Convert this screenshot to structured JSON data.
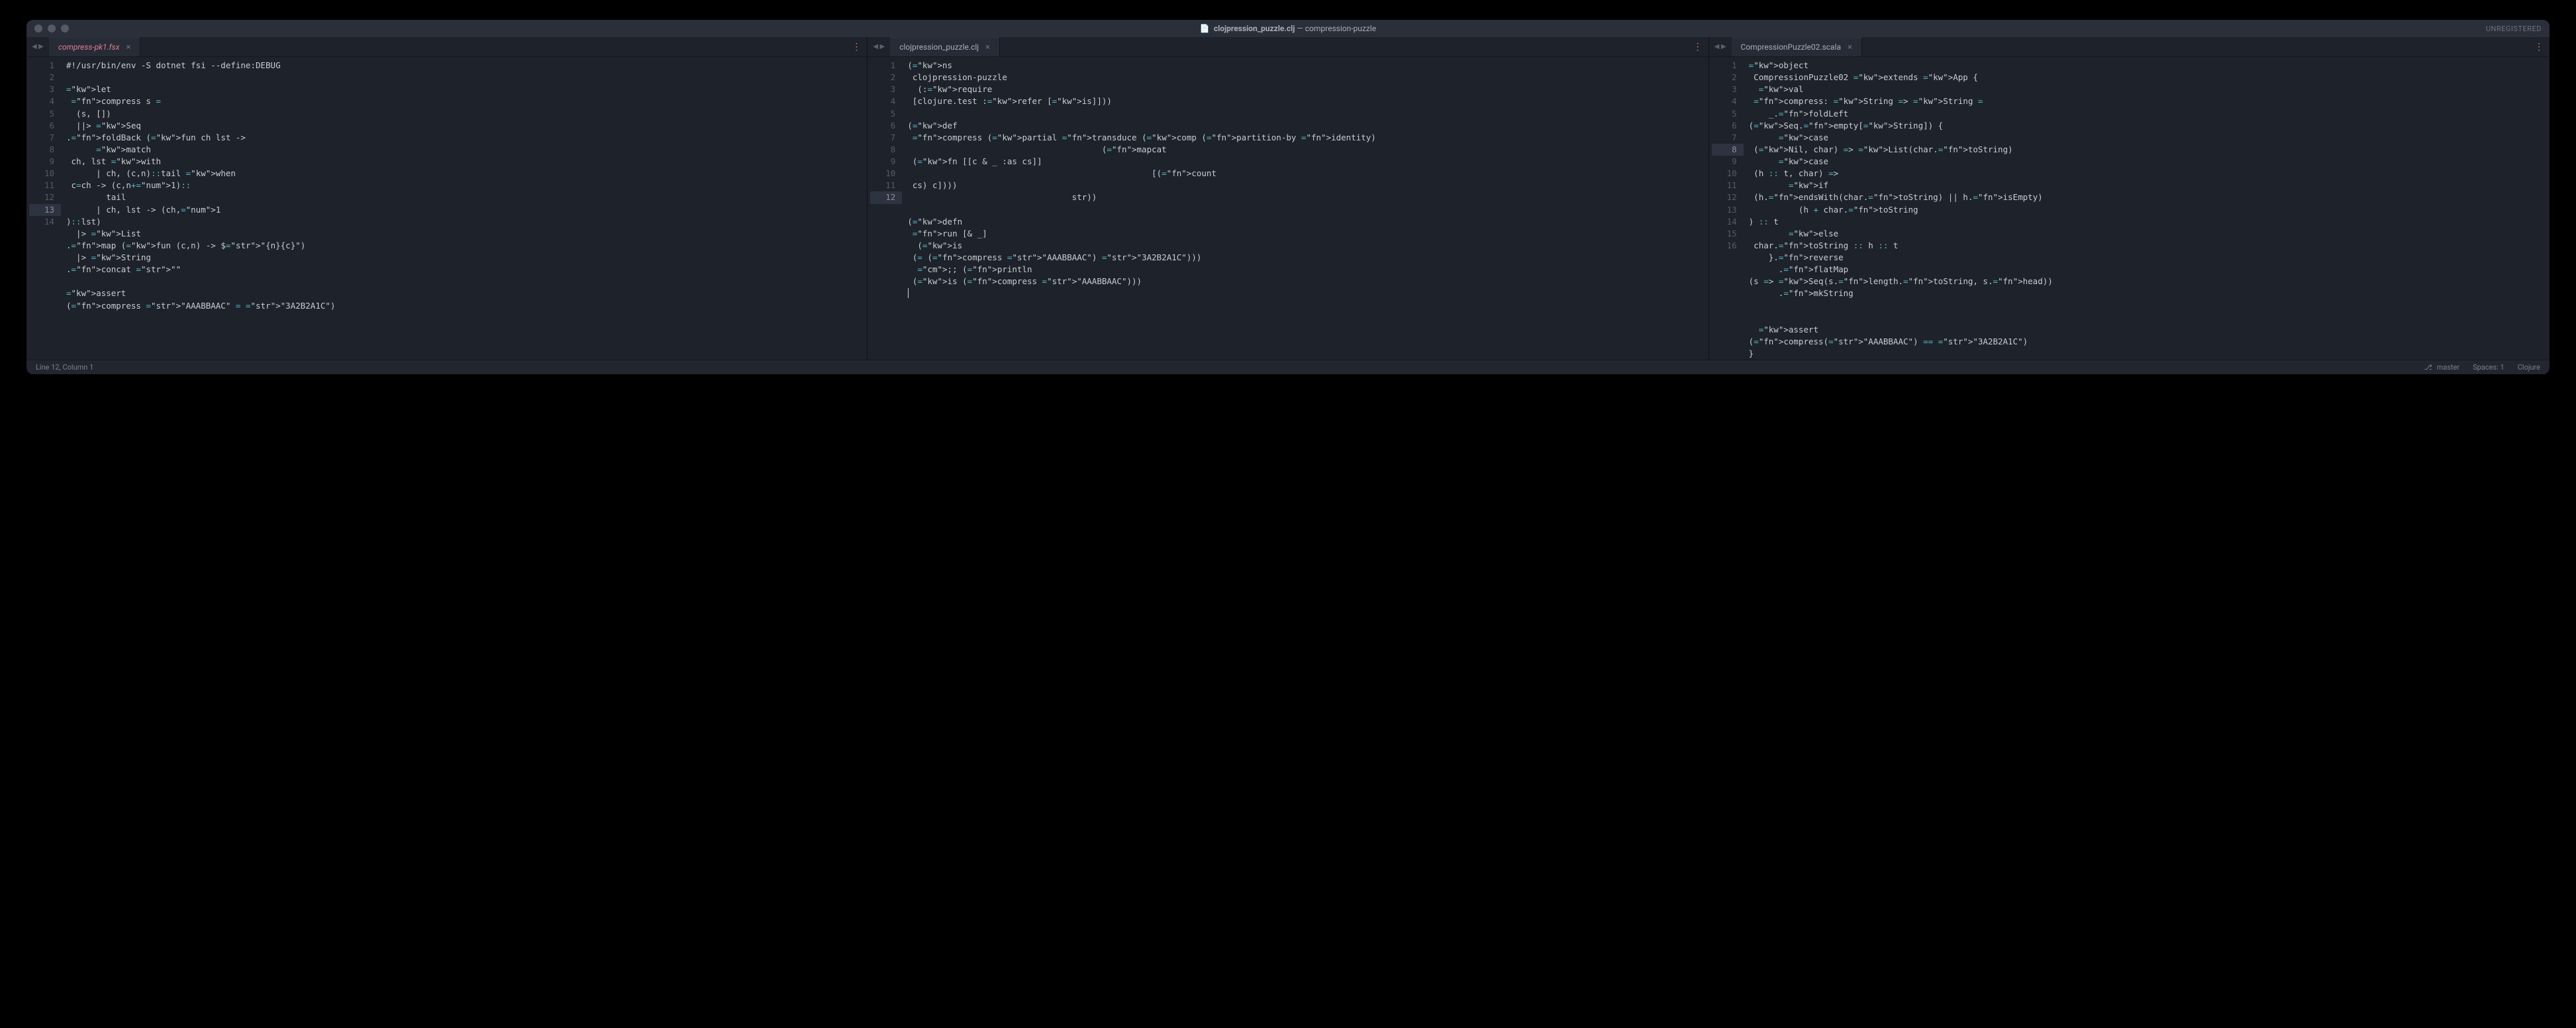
{
  "window": {
    "title_filename": "clojpression_puzzle.clj",
    "title_project": "compression-puzzle",
    "unregistered": "UNREGISTERED"
  },
  "panes": [
    {
      "tab": {
        "name": "compress-pk1.fsx",
        "dirty": true
      },
      "active_line": 13,
      "lines": [
        "#!/usr/bin/env -S dotnet fsi --define:DEBUG",
        "",
        "let compress s =",
        "  (s, [])",
        "  ||> Seq.foldBack (fun ch lst ->",
        "      match ch, lst with",
        "      | ch, (c,n)::tail when c=ch -> (c,n+1)::",
        "        tail",
        "      | ch, lst -> (ch,1)::lst)",
        "  |> List.map (fun (c,n) -> $\"{n}{c}\")",
        "  |> String.concat \"\"",
        "",
        "assert(compress \"AAABBAAC\" = \"3A2B2A1C\")",
        ""
      ]
    },
    {
      "tab": {
        "name": "clojpression_puzzle.clj",
        "dirty": false
      },
      "active_line": 12,
      "lines": [
        "(ns clojpression-puzzle",
        "  (:require [clojure.test :refer [is]]))",
        "",
        "(def compress (partial transduce (comp (partition-by identity)",
        "                                       (mapcat (fn [[c & _ :as cs]]",
        "                                                 [(count cs) c])))",
        "                                 str))",
        "",
        "(defn run [& _]",
        "  (is (= (compress \"AAABBAAC\") \"3A2B2A1C\")))",
        "  ;; (println (is (compress \"AAABBAAC\")))",
        ""
      ]
    },
    {
      "tab": {
        "name": "CompressionPuzzle02.scala",
        "dirty": false
      },
      "active_line": 8,
      "lines": [
        "object CompressionPuzzle02 extends App {",
        "  val compress: String => String =",
        "    _.foldLeft(Seq.empty[String]) {",
        "      case (Nil, char) => List(char.toString)",
        "      case (h :: t, char) =>",
        "        if (h.endsWith(char.toString) || h.isEmpty)",
        "          (h + char.toString) :: t",
        "        else char.toString :: h :: t",
        "    }.reverse",
        "      .flatMap(s => Seq(s.length.toString, s.head))",
        "      .mkString",
        "",
        "",
        "  assert(compress(\"AAABBAAC\") == \"3A2B2A1C\")",
        "}",
        ""
      ]
    }
  ],
  "status": {
    "position": "Line 12, Column 1",
    "branch": "master",
    "indent": "Spaces: 1",
    "lang": "Clojure"
  },
  "icons": {
    "file": "📄",
    "branch": "⎇"
  }
}
